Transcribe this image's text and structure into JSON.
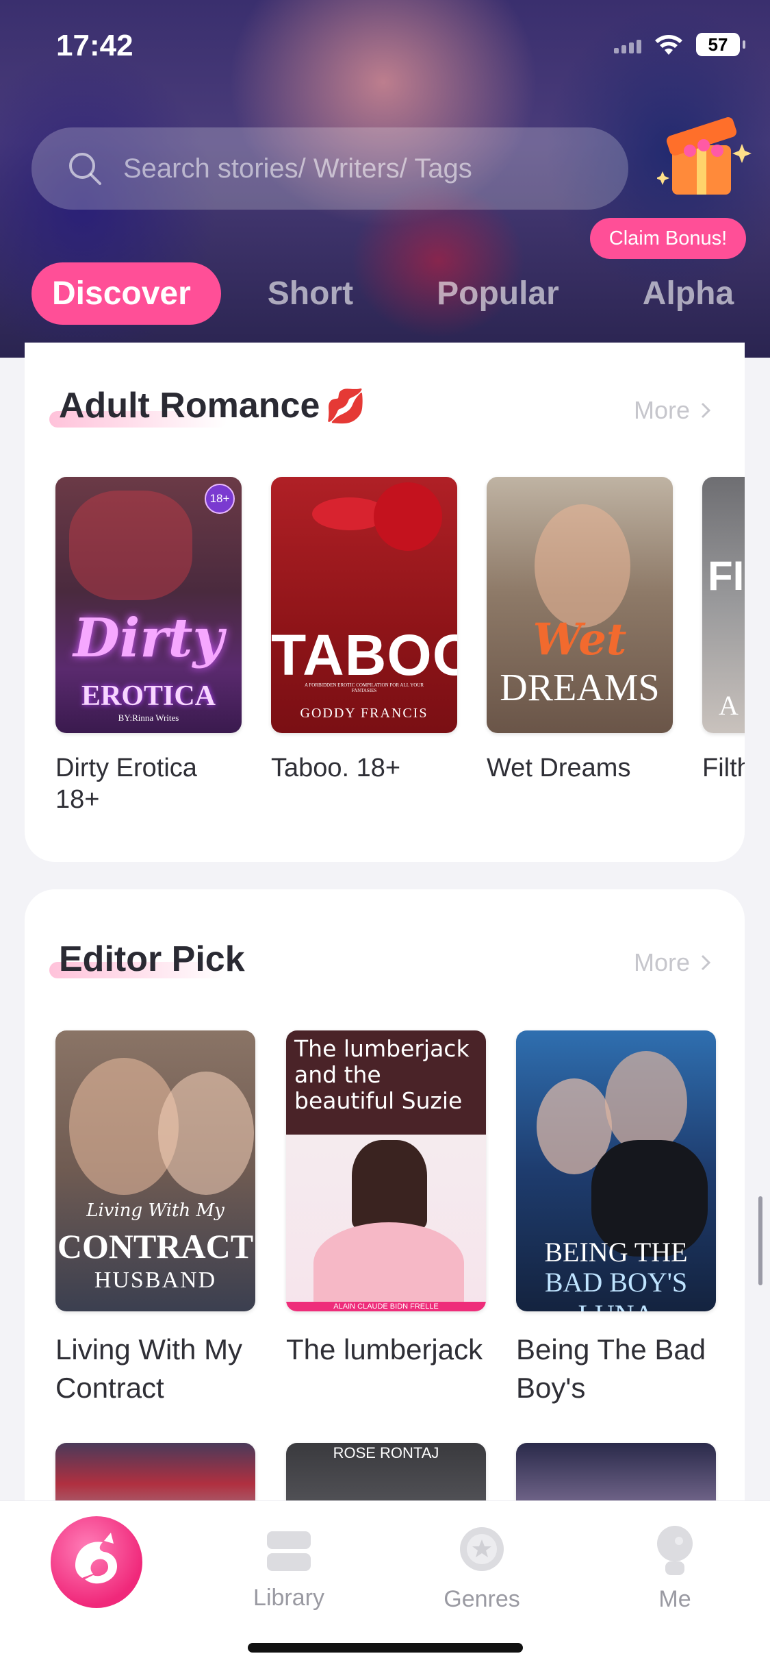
{
  "status_bar": {
    "time": "17:42",
    "battery": "57"
  },
  "search": {
    "placeholder": "Search stories/ Writers/ Tags"
  },
  "bonus": {
    "label": "Claim Bonus!"
  },
  "tabs": [
    {
      "label": "Discover"
    },
    {
      "label": "Short"
    },
    {
      "label": "Popular"
    },
    {
      "label": "Alpha"
    }
  ],
  "adult_romance": {
    "title": "Adult Romance",
    "emoji": "💋",
    "more_label": "More",
    "books": [
      {
        "title": "Dirty Erotica 18+",
        "cover_script": "Dirty",
        "cover_main": "EROTICA",
        "cover_author": "BY:Rinna Writes",
        "badge": "18+"
      },
      {
        "title": "Taboo. 18+",
        "cover_main": "TABOO",
        "cover_sub": "A FORBIDDEN EROTIC COMPILATION FOR ALL YOUR FANTASIES",
        "cover_author": "GODDY FRANCIS"
      },
      {
        "title": "Wet Dreams",
        "cover_script": "Wet",
        "cover_main": "DREAMS"
      },
      {
        "title": "Filth",
        "cover_main": "FI",
        "cover_sub": "A"
      }
    ]
  },
  "editor_pick": {
    "title": "Editor Pick",
    "more_label": "More",
    "books": [
      {
        "title": "Living With My Contract",
        "cover_script": "Living With My",
        "cover_main": "CONTRACT",
        "cover_sub": "HUSBAND"
      },
      {
        "title": "The lumberjack",
        "cover_main": "The lumberjack and the beautiful Suzie",
        "cover_sub": "ALAIN CLAUDE BIDN FRELLE"
      },
      {
        "title": "Being The Bad Boy's",
        "cover_main": "BEING THE",
        "cover_sub": "BAD BOY'S LUNA"
      }
    ],
    "row2_covers": [
      {
        "text": ""
      },
      {
        "text": "ROSE RONTAJ"
      },
      {
        "text": ""
      }
    ]
  },
  "bottom_nav": [
    {
      "label": "Library",
      "icon": "library-icon"
    },
    {
      "label": "Genres",
      "icon": "genres-icon"
    },
    {
      "label": "Me",
      "icon": "me-icon"
    }
  ],
  "colors": {
    "accent": "#ff4f97"
  }
}
